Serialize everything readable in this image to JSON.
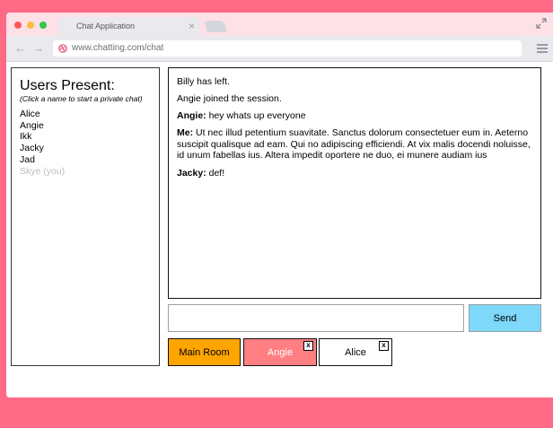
{
  "browser": {
    "tab_title": "Chat Application",
    "tab_close": "×",
    "url": "www.chatting.com/chat",
    "back_icon": "←",
    "forward_icon": "→"
  },
  "users": {
    "title": "Users Present:",
    "hint": "(Click a name to start a private chat)",
    "list": [
      "Alice",
      "Angie",
      "Ikk",
      "Jacky",
      "Jad"
    ],
    "self": "Skye (you)"
  },
  "messages": [
    {
      "author": "",
      "text": "Billy has left."
    },
    {
      "author": "",
      "text": "Angie joined the session."
    },
    {
      "author": "Angie:",
      "text": " hey whats up everyone"
    },
    {
      "author": "Me:",
      "text": " Ut nec illud petentium suavitate. Sanctus dolorum consectetuer eum in. Aeterno suscipit qualisque ad eam. Qui no adipiscing efficiendi. At vix malis docendi noluisse, id unum fabellas ius. Altera impedit oportere ne duo, ei munere audiam ius"
    },
    {
      "author": "Jacky:",
      "text": " def!"
    }
  ],
  "composer": {
    "input_value": "",
    "send_label": "Send"
  },
  "rooms": {
    "main": "Main Room",
    "angie": "Angie",
    "alice": "Alice",
    "close_label": "x"
  },
  "colors": {
    "background": "#ff6b86",
    "main_room": "#ffa500",
    "angie_room": "#ff7f82",
    "send_button": "#7dd8f9"
  }
}
